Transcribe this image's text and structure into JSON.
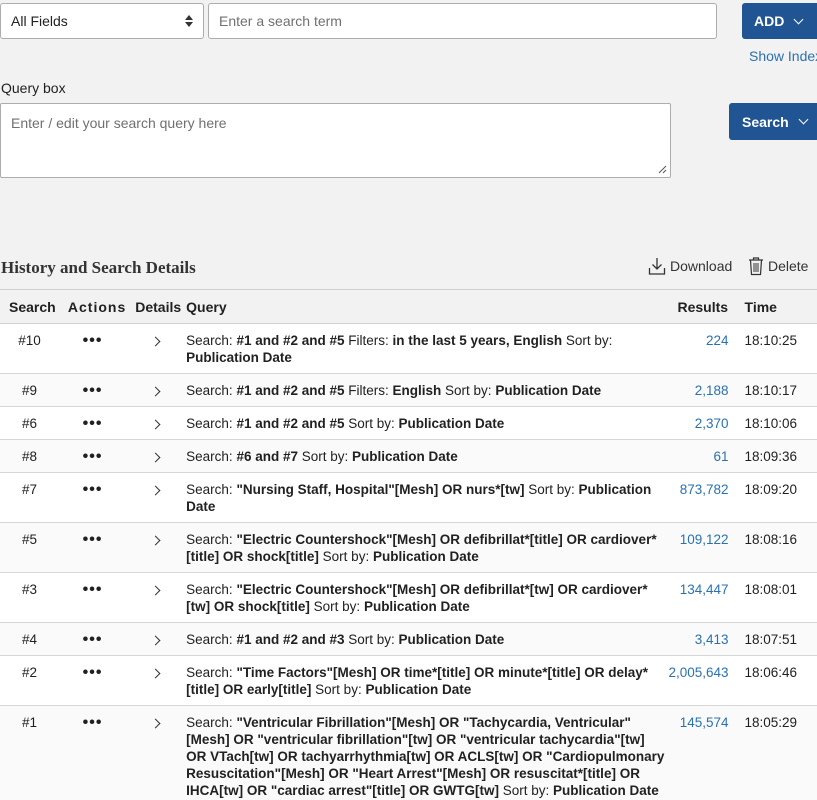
{
  "search_builder": {
    "field_select_value": "All Fields",
    "term_placeholder": "Enter a search term",
    "add_label": "ADD",
    "show_index_label": "Show Index"
  },
  "query_box": {
    "label": "Query box",
    "placeholder": "Enter / edit your search query here",
    "search_label": "Search"
  },
  "history": {
    "title": "History and Search Details",
    "download_label": "Download",
    "delete_label": "Delete",
    "columns": [
      "Search",
      "Actions",
      "Details",
      "Query",
      "Results",
      "Time"
    ],
    "rows": [
      {
        "num": "#10",
        "query_html": "Search: <b>#1 and #2 and #5</b> Filters: <b>in the last 5 years, English</b> Sort by: <b>Publication Date</b>",
        "results": "224",
        "time": "18:10:25"
      },
      {
        "num": "#9",
        "query_html": "Search: <b>#1 and #2 and #5</b> Filters: <b>English</b> Sort by: <b>Publication Date</b>",
        "results": "2,188",
        "time": "18:10:17"
      },
      {
        "num": "#6",
        "query_html": "Search: <b>#1 and #2 and #5</b> Sort by: <b>Publication Date</b>",
        "results": "2,370",
        "time": "18:10:06"
      },
      {
        "num": "#8",
        "query_html": "Search: <b>#6 and #7</b> Sort by: <b>Publication Date</b>",
        "results": "61",
        "time": "18:09:36"
      },
      {
        "num": "#7",
        "query_html": "Search: <b>\"Nursing Staff, Hospital\"[Mesh] OR nurs*[tw]</b> Sort by: <b>Publication Date</b>",
        "results": "873,782",
        "time": "18:09:20"
      },
      {
        "num": "#5",
        "query_html": "Search: <b>\"Electric Countershock\"[Mesh] OR defibrillat*[title] OR cardiover*[title] OR shock[title]</b> Sort by: <b>Publication Date</b>",
        "results": "109,122",
        "time": "18:08:16"
      },
      {
        "num": "#3",
        "query_html": "Search: <b>\"Electric Countershock\"[Mesh] OR defibrillat*[tw] OR cardiover*[tw] OR shock[title]</b> Sort by: <b>Publication Date</b>",
        "results": "134,447",
        "time": "18:08:01"
      },
      {
        "num": "#4",
        "query_html": "Search: <b>#1 and #2 and #3</b> Sort by: <b>Publication Date</b>",
        "results": "3,413",
        "time": "18:07:51"
      },
      {
        "num": "#2",
        "query_html": "Search: <b>\"Time Factors\"[Mesh] OR time*[title] OR minute*[title] OR delay*[title] OR early[title]</b> Sort by: <b>Publication Date</b>",
        "results": "2,005,643",
        "time": "18:06:46"
      },
      {
        "num": "#1",
        "query_html": "Search: <b>\"Ventricular Fibrillation\"[Mesh] OR \"Tachycardia, Ventricular\"[Mesh] OR \"ventricular fibrillation\"[tw] OR \"ventricular tachycardia\"[tw] OR VTach[tw] OR tachyarrhythmia[tw] OR ACLS[tw] OR \"Cardiopulmonary Resuscitation\"[Mesh] OR \"Heart Arrest\"[Mesh] OR resuscitat*[title] OR IHCA[tw] OR \"cardiac arrest\"[title] OR GWTG[tw]</b> Sort by: <b>Publication Date</b>",
        "results": "145,574",
        "time": "18:05:29"
      }
    ]
  }
}
